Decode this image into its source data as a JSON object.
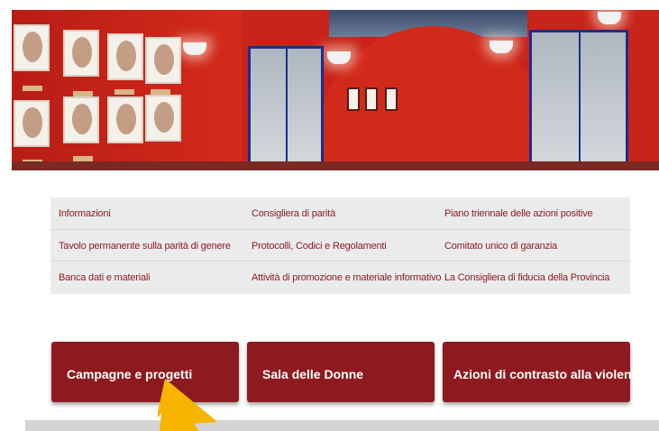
{
  "hero": {
    "description_icon": "gallery-photo"
  },
  "links": {
    "rows": [
      [
        "Informazioni",
        "Consigliera di parità",
        "Piano triennale delle azioni positive"
      ],
      [
        "Tavolo permanente sulla parità di genere",
        "Protocolli, Codici e Regolamenti",
        "Comitato unico di garanzia"
      ],
      [
        "Banca dati e materiali",
        "Attività di promozione e materiale informativo",
        "La Consigliera di fiducia della Provincia"
      ]
    ]
  },
  "buttons": {
    "campaigns": "Campagne e progetti",
    "sala": "Sala delle Donne",
    "violenza": "Azioni di contrasto alla violenza"
  },
  "colors": {
    "accent": "#8c1a1f",
    "link": "#8b1a1f",
    "cursor": "#f7b500"
  },
  "cursor_icon": "arrow-cursor-icon"
}
